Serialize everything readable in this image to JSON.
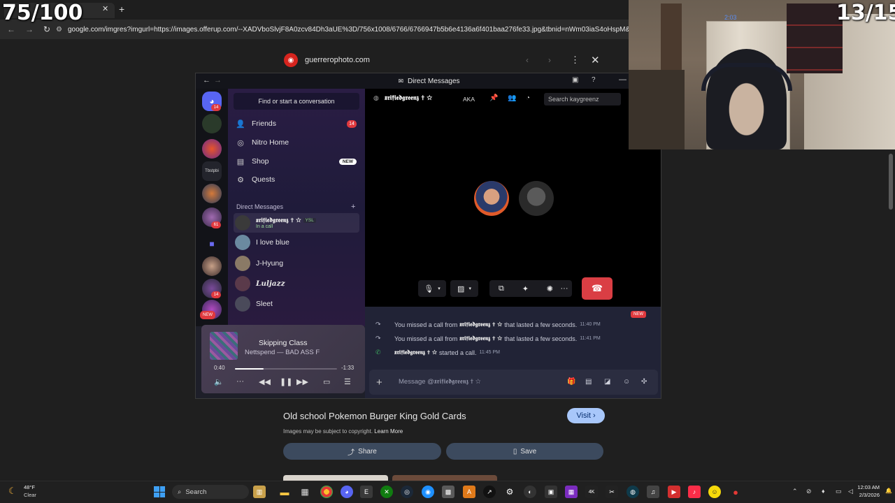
{
  "browser": {
    "tab_title": "",
    "url": "google.com/imgres?imgurl=https://images.offerup.com/--XADVboSlvjF8A0zcv84Dh3aUE%3D/756x1008/6766/6766947b5b6e4136a6f401baa276fe33.jpg&tbnid=nWm03iaS4oHspM&vet=1&img"
  },
  "viewer": {
    "site": "guerrerophoto.com",
    "image_title": "Old school Pokemon Burger King Gold Cards",
    "visit_label": "Visit",
    "copyright_text": "Images may be subject to copyright.",
    "learn_more": "Learn More",
    "share_label": "Share",
    "save_label": "Save"
  },
  "discord": {
    "window_title": "Direct Messages",
    "find_placeholder": "Find or start a conversation",
    "nav": [
      {
        "label": "Friends",
        "badge": "14",
        "icon": "friends-icon"
      },
      {
        "label": "Nitro Home",
        "badge": "",
        "icon": "nitro-icon"
      },
      {
        "label": "Shop",
        "badge": "NEW",
        "icon": "shop-icon"
      },
      {
        "label": "Quests",
        "badge": "",
        "icon": "quests-icon"
      }
    ],
    "dm_header": "Direct Messages",
    "dms": [
      {
        "name": "𝖝𝖗𝖎𝖋𝖎𝖊𝖉𝖌𝖗𝖊𝖊𝖓𝖟 ✝ ☆",
        "tag": "YSL",
        "status": "In a call",
        "color": "#3a3a3a"
      },
      {
        "name": "I love blue",
        "tag": "",
        "status": "",
        "color": "#6b8aa0"
      },
      {
        "name": "J-Hyung",
        "tag": "",
        "status": "",
        "color": "#8a7a66"
      },
      {
        "name": "Luljazz",
        "tag": "",
        "status": "",
        "color": "#5a3a4a"
      },
      {
        "name": "Sleet",
        "tag": "",
        "status": "",
        "color": "#4a4a5a"
      }
    ],
    "server_badges": {
      "home": "14",
      "s3": "61",
      "s7": "14"
    },
    "server_labels": {
      "s4": "Tbstpbi",
      "new": "NEW"
    },
    "now_playing": {
      "title": "Skipping Class",
      "artist": "Nettspend — BAD ASS F",
      "elapsed": "0:40",
      "remaining": "-1:33",
      "progress": 0.28
    },
    "call": {
      "user": "𝖝𝖗𝖎𝖋𝖎𝖊𝖉𝖌𝖗𝖊𝖊𝖓𝖟 ✝ ☆",
      "aka": "AKA",
      "search_placeholder": "Search kaygreenz"
    },
    "messages": [
      {
        "prefix": "You missed a call from",
        "user": "𝖝𝖗𝖎𝖋𝖎𝖊𝖉𝖌𝖗𝖊𝖊𝖓𝖟 ✝ ☆",
        "suffix": "that lasted a few seconds.",
        "time": "11:40 PM"
      },
      {
        "prefix": "You missed a call from",
        "user": "𝖝𝖗𝖎𝖋𝖎𝖊𝖉𝖌𝖗𝖊𝖊𝖓𝖟 ✝ ☆",
        "suffix": "that lasted a few seconds.",
        "time": "11:41 PM"
      },
      {
        "prefix": "",
        "user": "𝖝𝖗𝖎𝖋𝖎𝖊𝖉𝖌𝖗𝖊𝖊𝖓𝖟 ✝ ☆",
        "suffix": "started a call.",
        "time": "11:45 PM"
      }
    ],
    "new_marker": "NEW",
    "composer_placeholder": "Message @𝖝𝖗𝖎𝖋𝖎𝖊𝖉𝖌𝖗𝖊𝖊𝖓𝖟 ✝ ☆"
  },
  "overlay": {
    "counter_left": "75/100",
    "counter_right": "13/15",
    "cam_clock": "2:03"
  },
  "taskbar": {
    "weather_temp": "48°F",
    "weather_cond": "Clear",
    "search_label": "Search",
    "time": "12:03 AM",
    "date": "2/3/2026"
  },
  "colors": {
    "discord_red": "#da3e44",
    "visit_blue": "#a8c7fa",
    "badge_red": "#e0393e"
  }
}
